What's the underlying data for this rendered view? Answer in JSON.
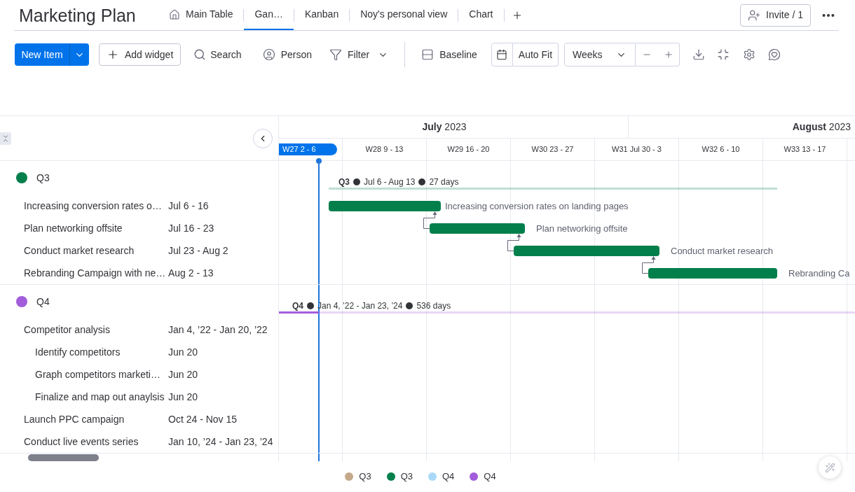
{
  "board": {
    "title": "Marketing Plan"
  },
  "tabs": [
    {
      "label": "Main Table",
      "kind": "home",
      "selected": false
    },
    {
      "label": "Gan…",
      "kind": "view",
      "selected": true
    },
    {
      "label": "Kanban",
      "kind": "view",
      "selected": false
    },
    {
      "label": "Noy's personal view",
      "kind": "view",
      "selected": false
    },
    {
      "label": "Chart",
      "kind": "view",
      "selected": false
    }
  ],
  "invite_button": {
    "label": "Invite / 1"
  },
  "toolbar": {
    "new_item": "New Item",
    "add_widget": "Add widget",
    "search": "Search",
    "person": "Person",
    "filter": "Filter",
    "baseline": "Baseline",
    "auto_fit": "Auto Fit",
    "time_scale": "Weeks"
  },
  "timeline": {
    "months": [
      "**July** 2023",
      "**August** 2023"
    ],
    "weeks": [
      {
        "label": "W27 2 - 6",
        "selected": true
      },
      {
        "label": "W28 9 - 13",
        "selected": false
      },
      {
        "label": "W29 16 - 20",
        "selected": false
      },
      {
        "label": "W30 23 - 27",
        "selected": false
      },
      {
        "label": "W31 Jul 30 - 3",
        "selected": false
      },
      {
        "label": "W32 6 - 10",
        "selected": false
      },
      {
        "label": "W33 13 - 17",
        "selected": false
      }
    ]
  },
  "groups": [
    {
      "name": "Q3",
      "color": "#037f4c",
      "summary": {
        "name": "Q3",
        "dates": "Jul 6 - Aug 13",
        "duration": "27 days"
      },
      "items": [
        {
          "name": "Increasing conversion rates o…",
          "dates": "Jul 6 - 16",
          "bar_label": "Increasing conversion rates on landing pages"
        },
        {
          "name": "Plan networking offsite",
          "dates": "Jul 16 - 23",
          "bar_label": "Plan networking offsite"
        },
        {
          "name": "Conduct market research",
          "dates": "Jul 23 - Aug 2",
          "bar_label": "Conduct market research"
        },
        {
          "name": "Rebranding Campaign with ne…",
          "dates": "Aug 2 - 13",
          "bar_label": "Rebranding Ca"
        }
      ]
    },
    {
      "name": "Q4",
      "color": "#a25ddc",
      "summary": {
        "name": "Q4",
        "dates": "Jan 4, ’22 - Jan 23, ’24",
        "duration": "536 days"
      },
      "items": [
        {
          "name": "Competitor analysis",
          "dates": "Jan 4, ’22 - Jan 20, ’22",
          "children": [
            {
              "name": "Identify competitors",
              "dates": "Jun 20"
            },
            {
              "name": "Graph competitors marketi…",
              "dates": "Jun 20"
            },
            {
              "name": "Finalize and map out anaylsis",
              "dates": "Jun 20"
            }
          ]
        },
        {
          "name": "Launch PPC campaign",
          "dates": "Oct 24 - Nov 15"
        },
        {
          "name": "Conduct live events series",
          "dates": "Jan 10, ’24 - Jan 23, ’24"
        }
      ]
    }
  ],
  "legend": [
    {
      "label": "Q3",
      "color": "#c4a98a"
    },
    {
      "label": "Q3",
      "color": "#037f4c"
    },
    {
      "label": "Q4",
      "color": "#aad9f7"
    },
    {
      "label": "Q4",
      "color": "#a25ddc"
    }
  ]
}
